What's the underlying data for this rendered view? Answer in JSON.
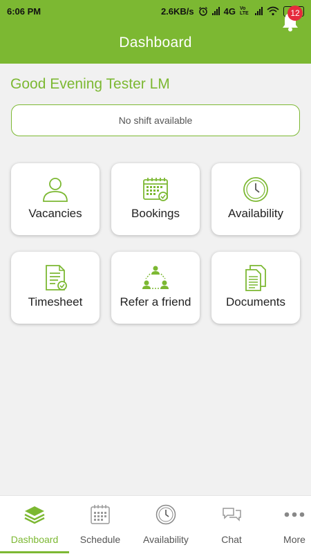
{
  "status_bar": {
    "time": "6:06 PM",
    "network_speed": "2.6KB/s",
    "network_type": "4G",
    "volte": "Vo LTE",
    "battery": "58",
    "icons": [
      "alarm-icon",
      "signal-icon",
      "wifi-icon",
      "battery-icon"
    ]
  },
  "app_bar": {
    "title": "Dashboard",
    "notification_count": "12"
  },
  "greeting": "Good Evening Tester LM",
  "shift_status": "No shift available",
  "tiles": [
    {
      "label": "Vacancies",
      "icon": "person-icon"
    },
    {
      "label": "Bookings",
      "icon": "calendar-check-icon"
    },
    {
      "label": "Availability",
      "icon": "clock-icon"
    },
    {
      "label": "Timesheet",
      "icon": "document-check-icon"
    },
    {
      "label": "Refer a friend",
      "icon": "people-network-icon"
    },
    {
      "label": "Documents",
      "icon": "documents-icon"
    }
  ],
  "bottom_nav": {
    "items": [
      {
        "label": "Dashboard",
        "icon": "layers-icon",
        "active": true
      },
      {
        "label": "Schedule",
        "icon": "calendar-icon",
        "active": false
      },
      {
        "label": "Availability",
        "icon": "clock-icon",
        "active": false
      },
      {
        "label": "Chat",
        "icon": "chat-bubbles-icon",
        "active": false
      },
      {
        "label": "More",
        "icon": "more-dots-icon",
        "active": false
      }
    ]
  },
  "colors": {
    "brand_green": "#7cb832",
    "badge_red": "#e52b3d",
    "background": "#f1f1f1"
  }
}
